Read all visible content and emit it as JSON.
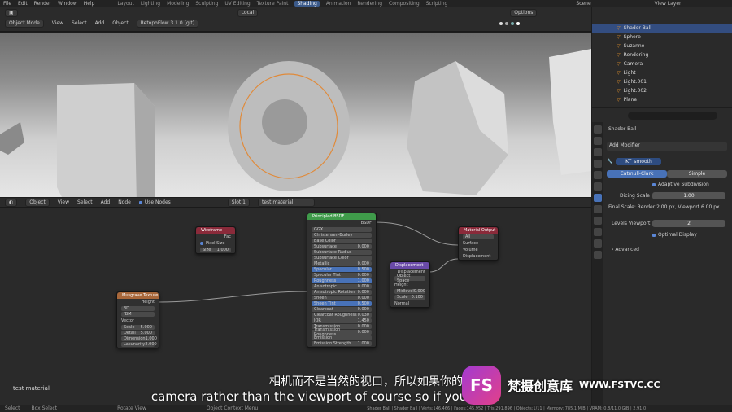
{
  "menubar": {
    "items": [
      "File",
      "Edit",
      "Render",
      "Window",
      "Help"
    ],
    "workspaces": [
      "Layout",
      "Lighting",
      "Modeling",
      "Sculpting",
      "UV Editing",
      "Texture Paint",
      "Shading",
      "Animation",
      "Rendering",
      "Compositing",
      "Scripting"
    ],
    "active_workspace": "Shading",
    "scene": "Scene",
    "view_layer": "View Layer"
  },
  "viewport_header": {
    "orientation": "Local",
    "options": "Options",
    "mode": "Object Mode",
    "menus": [
      "View",
      "Select",
      "Add",
      "Object"
    ],
    "addon": "RetopoFlow 3.1.0 (git)"
  },
  "outliner": {
    "items": [
      {
        "label": "Shader Ball",
        "selected": true
      },
      {
        "label": "Sphere",
        "selected": false
      },
      {
        "label": "Suzanne",
        "selected": false
      },
      {
        "label": "Rendering",
        "selected": false
      },
      {
        "label": "Camera",
        "selected": false
      },
      {
        "label": "Light",
        "selected": false
      },
      {
        "label": "Light.001",
        "selected": false
      },
      {
        "label": "Light.002",
        "selected": false
      },
      {
        "label": "Plane",
        "selected": false
      }
    ]
  },
  "properties": {
    "object_name": "Shader Ball",
    "add_modifier": "Add Modifier",
    "modifier_name": "KT_smooth",
    "tabs": [
      "Catmull-Clark",
      "Simple"
    ],
    "adaptive_subdivision": "Adaptive Subdivision",
    "dicing_scale_label": "Dicing Scale",
    "dicing_scale_value": "1.00",
    "final_scale": "Final Scale: Render 2.00 px, Viewport 6.00 px",
    "levels_viewport_label": "Levels Viewport",
    "levels_viewport_value": "2",
    "optimal_display": "Optimal Display",
    "advanced": "Advanced"
  },
  "node_header": {
    "type": "Object",
    "menus": [
      "View",
      "Select",
      "Add",
      "Node"
    ],
    "use_nodes": "Use Nodes",
    "slot": "Slot 1",
    "material": "test material"
  },
  "nodes": {
    "wireframe": {
      "title": "Wireframe",
      "out": "Fac",
      "pixel_size": "Pixel Size",
      "size_label": "Size",
      "size_value": "1.000"
    },
    "musgrave": {
      "title": "Musgrave Texture",
      "out": "Height",
      "dim": "3D",
      "type": "fBM",
      "vector": "Vector",
      "fields": [
        [
          "Scale",
          "5.000"
        ],
        [
          "Detail",
          "5.000"
        ],
        [
          "Dimension",
          "1.000"
        ],
        [
          "Lacunarity",
          "2.000"
        ]
      ]
    },
    "principled": {
      "title": "Principled BSDF",
      "out": "BSDF",
      "dist": "GGX",
      "sss": "Christensen-Burley",
      "fields": [
        [
          "Base Color",
          ""
        ],
        [
          "Subsurface",
          "0.000"
        ],
        [
          "Subsurface Radius",
          ""
        ],
        [
          "Subsurface Color",
          ""
        ],
        [
          "Metallic",
          "0.000"
        ],
        [
          "Specular",
          "0.500"
        ],
        [
          "Specular Tint",
          "0.000"
        ],
        [
          "Roughness",
          "1.000"
        ],
        [
          "Anisotropic",
          "0.000"
        ],
        [
          "Anisotropic Rotation",
          "0.000"
        ],
        [
          "Sheen",
          "0.000"
        ],
        [
          "Sheen Tint",
          "0.500"
        ],
        [
          "Clearcoat",
          "0.000"
        ],
        [
          "Clearcoat Roughness",
          "0.030"
        ],
        [
          "IOR",
          "1.450"
        ],
        [
          "Transmission",
          "0.000"
        ],
        [
          "Transmission Roughness",
          "0.000"
        ],
        [
          "Emission",
          ""
        ],
        [
          "Emission Strength",
          "1.000"
        ]
      ]
    },
    "displacement": {
      "title": "Displacement",
      "out": "Displacement",
      "space": "Object Space",
      "height": "Height",
      "fields": [
        [
          "Midlevel",
          "0.000"
        ],
        [
          "Scale",
          "0.100"
        ]
      ],
      "normal": "Normal"
    },
    "material_output": {
      "title": "Material Output",
      "target": "All",
      "inputs": [
        "Surface",
        "Volume",
        "Displacement"
      ]
    }
  },
  "node_label": "test material",
  "statusbar": {
    "items": [
      "Select",
      "Box Select",
      "Rotate View",
      "Object Context Menu"
    ],
    "stats": "Shader Ball | Shader Ball | Verts:146,466 | Faces:145,952 | Tris:291,896 | Objects:1/11 | Memory: 785.1 MiB | VRAM: 0.8/11.0 GiB | 2.91.0"
  },
  "subtitles": {
    "cn": "相机而不是当然的视口，所以如果你的",
    "en": "camera rather than the viewport of course so if you"
  },
  "watermark": {
    "logo": "FS",
    "text": "梵摄创意库",
    "url": "WWW.FSTVC.CC"
  },
  "colors": {
    "accent": "#3b5a8a",
    "node_shader": "#3f9b4a",
    "node_vector": "#6a4aa8",
    "node_texture": "#a8673a",
    "node_output": "#8a2a3a"
  }
}
